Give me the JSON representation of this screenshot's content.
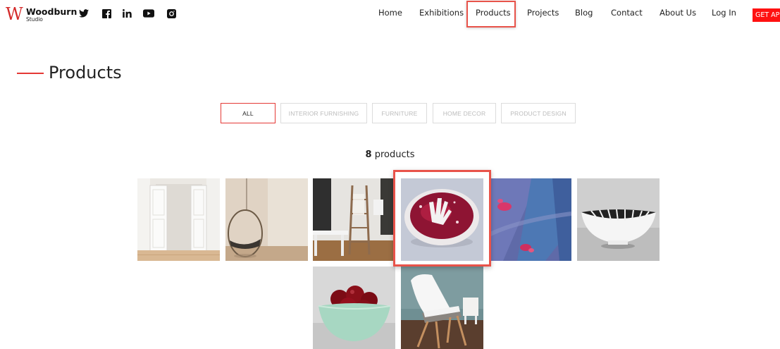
{
  "brand": {
    "mark": "W",
    "name": "Woodburn",
    "sub": "Studio",
    "accent": "#e53935"
  },
  "social": [
    {
      "icon": "twitter-icon"
    },
    {
      "icon": "facebook-icon"
    },
    {
      "icon": "linkedin-icon"
    },
    {
      "icon": "youtube-icon"
    },
    {
      "icon": "instagram-icon"
    }
  ],
  "nav": {
    "items": [
      "Home",
      "Exhibitions",
      "Products",
      "Projects",
      "Blog",
      "Contact",
      "About Us",
      "Log In"
    ],
    "active": "Products",
    "cta": "GET API"
  },
  "page": {
    "title": "Products"
  },
  "filters": {
    "items": [
      "ALL",
      "INTERIOR FURNISHING",
      "FURNITURE",
      "HOME DECOR",
      "PRODUCT DESIGN"
    ],
    "selected": "ALL"
  },
  "results": {
    "count": "8",
    "label": "products"
  },
  "products": [
    {
      "image": "white-double-doors"
    },
    {
      "image": "hanging-rattan-chair"
    },
    {
      "image": "ladder-shelf-living-room"
    },
    {
      "image": "red-handprint-bowl"
    },
    {
      "image": "abstract-blue-pink-painting"
    },
    {
      "image": "striped-ceramic-bowl"
    },
    {
      "image": "green-bowl-red-fruit"
    },
    {
      "image": "white-chair-wooden-legs"
    }
  ]
}
